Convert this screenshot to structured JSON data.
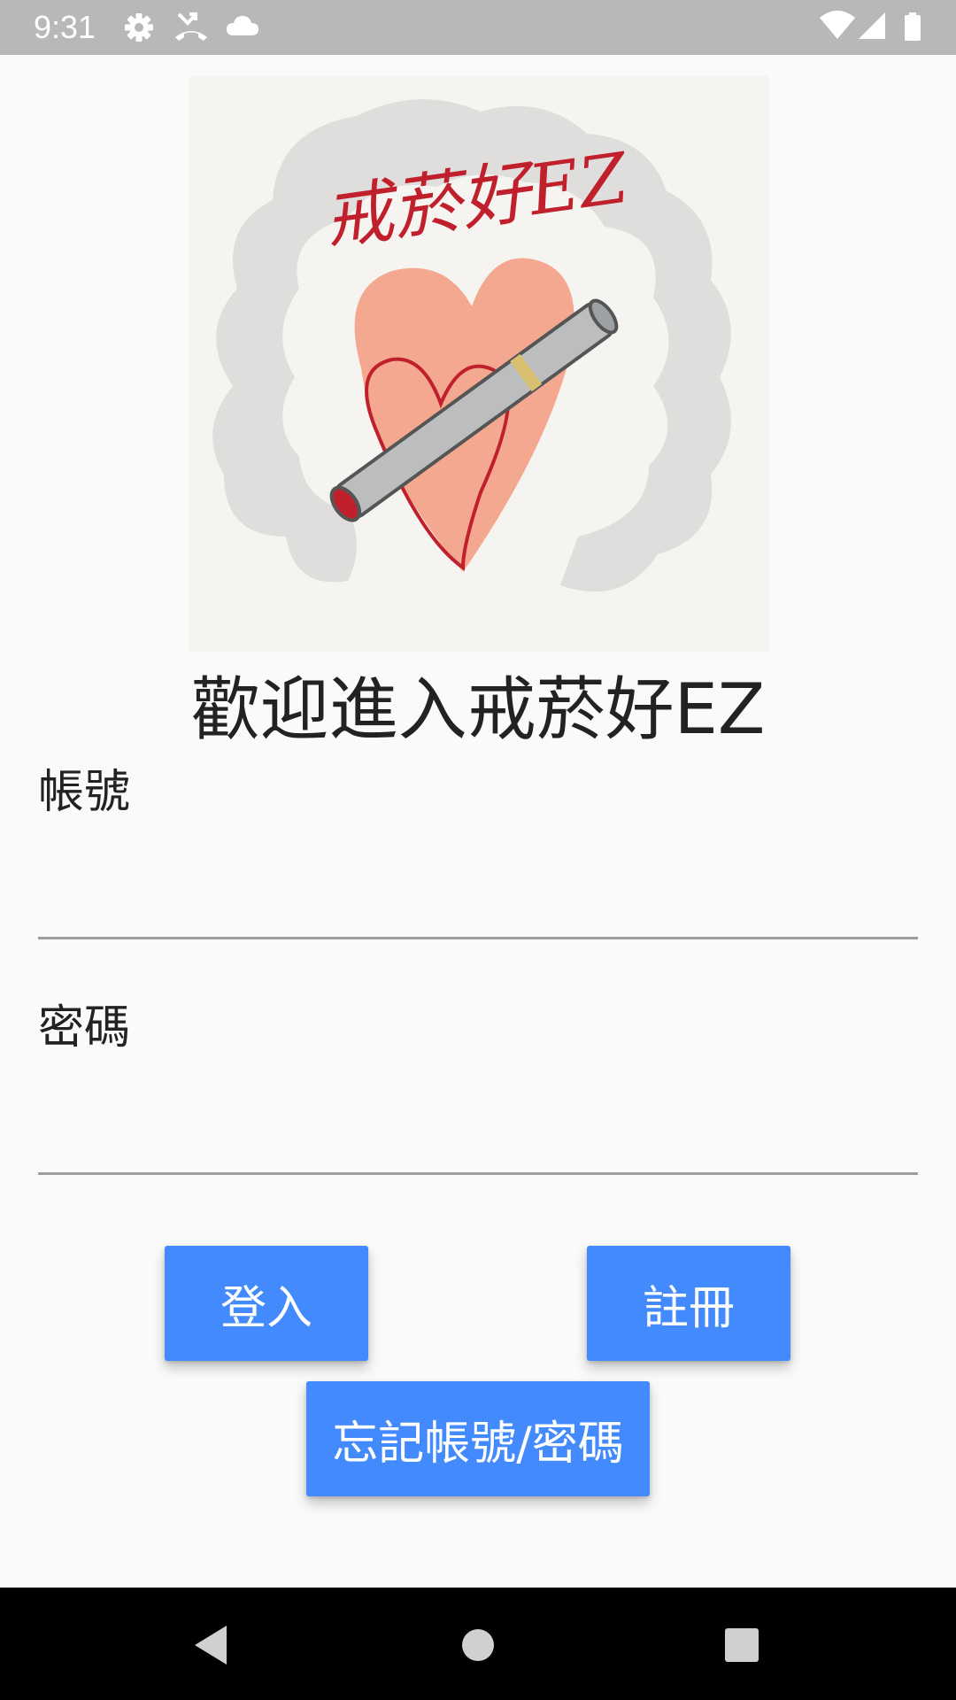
{
  "status_bar": {
    "time": "9:31",
    "icons_left": [
      "settings-icon",
      "missed-call-icon",
      "cloud-icon"
    ],
    "icons_right": [
      "wifi-icon",
      "cell-signal-icon",
      "battery-icon"
    ]
  },
  "logo": {
    "text": "戒菸好EZ",
    "icon": "heart-cigarette-logo"
  },
  "welcome_title": "歡迎進入戒菸好EZ",
  "account": {
    "label": "帳號",
    "value": ""
  },
  "password": {
    "label": "密碼",
    "value": ""
  },
  "buttons": {
    "login": "登入",
    "register": "註冊",
    "forgot": "忘記帳號/密碼"
  },
  "colors": {
    "button_bg": "#448aff",
    "status_bar": "#b8b8b8",
    "nav_bar": "#000000",
    "background": "#fafafa"
  }
}
